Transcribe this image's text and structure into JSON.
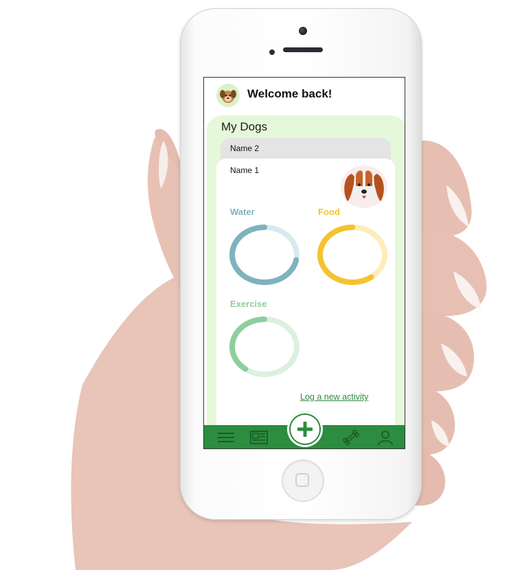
{
  "header": {
    "title": "Welcome back!"
  },
  "section": {
    "title": "My Dogs"
  },
  "dogs": [
    {
      "name": "Name 1"
    },
    {
      "name": "Name 2"
    }
  ],
  "metrics": [
    {
      "label": "Water",
      "progress": 0.72,
      "color": "#7fb2bf",
      "track": "#d6ebef"
    },
    {
      "label": "Food",
      "progress": 0.6,
      "color": "#f4c330",
      "track": "#fdedb8"
    },
    {
      "label": "Exercise",
      "progress": 0.4,
      "color": "#8fce9c",
      "track": "#dcf0df"
    }
  ],
  "actions": {
    "log_activity": "Log a new activity"
  },
  "nav": {
    "items": [
      {
        "icon": "menu-icon"
      },
      {
        "icon": "news-icon"
      },
      {
        "icon": "add-icon"
      },
      {
        "icon": "bone-icon"
      },
      {
        "icon": "user-icon"
      }
    ],
    "color": "#2c8c3f"
  }
}
